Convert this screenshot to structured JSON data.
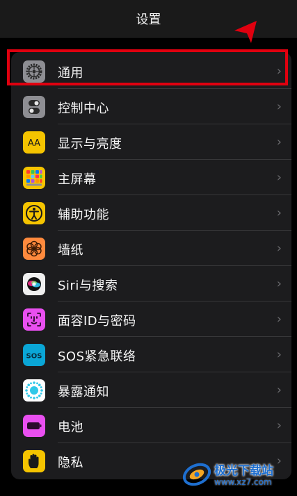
{
  "header": {
    "title": "设置"
  },
  "settings": [
    {
      "label": "通用",
      "icon": "gear-icon",
      "color": "#8e8e93"
    },
    {
      "label": "控制中心",
      "icon": "toggles-icon",
      "color": "#8e8e93"
    },
    {
      "label": "显示与亮度",
      "icon": "text-size-icon",
      "color": "#f5c400"
    },
    {
      "label": "主屏幕",
      "icon": "app-grid-icon",
      "color": "#f5c400"
    },
    {
      "label": "辅助功能",
      "icon": "accessibility-icon",
      "color": "#f5c400"
    },
    {
      "label": "墙纸",
      "icon": "flower-icon",
      "color": "#ff8a3d"
    },
    {
      "label": "Siri与搜索",
      "icon": "siri-icon",
      "color": "#ffffff"
    },
    {
      "label": "面容ID与密码",
      "icon": "face-id-icon",
      "color": "#e94ff0"
    },
    {
      "label": "SOS紧急联络",
      "icon": "sos-icon",
      "color": "#0aa6d6"
    },
    {
      "label": "暴露通知",
      "icon": "exposure-icon",
      "color": "#ffffff"
    },
    {
      "label": "电池",
      "icon": "battery-icon",
      "color": "#e94ff0"
    },
    {
      "label": "隐私",
      "icon": "hand-icon",
      "color": "#f5c400"
    }
  ],
  "chevron": "›",
  "sos_text": "SOS",
  "aa_text": "AA",
  "watermark": {
    "name": "极光下载站",
    "url": "www.xz7.com"
  }
}
